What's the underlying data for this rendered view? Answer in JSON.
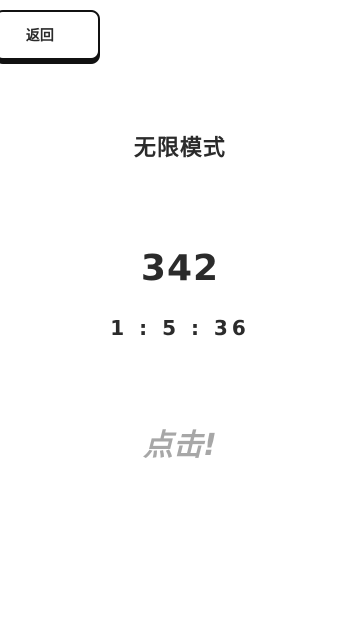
{
  "header": {
    "back_label": "返回"
  },
  "game": {
    "mode_title": "无限模式",
    "score": "342",
    "timer": "1 : 5 : 36",
    "tap_label": "点击!"
  },
  "colors": {
    "background": "#ffffff",
    "text": "#2b2b2b",
    "tap_text": "#a7a7a7",
    "button_border": "#111111"
  }
}
